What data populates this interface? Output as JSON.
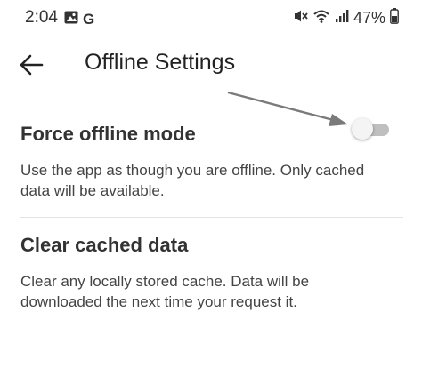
{
  "status_bar": {
    "time": "2:04",
    "notification_icons": [
      "image-icon",
      "google-g-icon"
    ],
    "google_letter": "G",
    "system_icons": [
      "mute-icon",
      "wifi-icon",
      "signal-icon",
      "battery-icon"
    ],
    "battery": "47%"
  },
  "app_bar": {
    "back_icon": "arrow-left-icon",
    "title": "Offline Settings"
  },
  "settings": [
    {
      "title": "Force offline mode",
      "description": "Use the app as though you are offline. Only cached data will be available.",
      "toggle_on": false
    },
    {
      "title": "Clear cached data",
      "description": "Clear any locally stored cache. Data will be downloaded the next time your request it."
    }
  ],
  "colors": {
    "annotation_arrow": "#7a7a7a",
    "toggle_track_off": "#bfbfbf",
    "divider": "#e3e3e3"
  }
}
